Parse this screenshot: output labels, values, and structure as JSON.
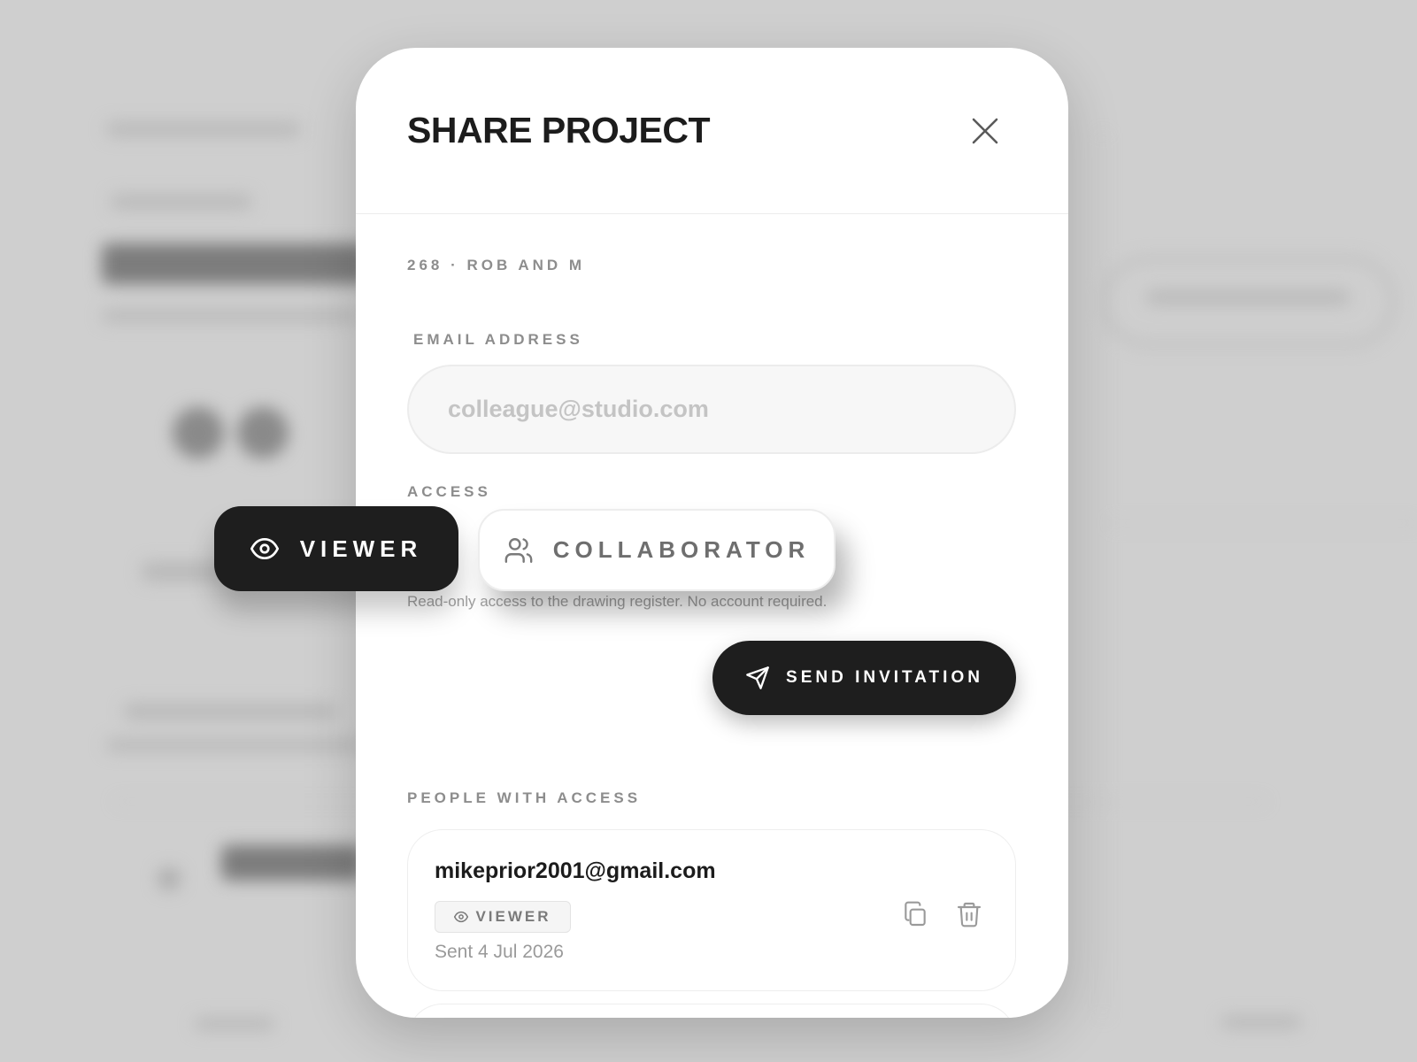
{
  "modal": {
    "title": "SHARE PROJECT",
    "project_ref": "268 · ROB AND M",
    "email_label": "EMAIL ADDRESS",
    "email_placeholder": "colleague@studio.com",
    "email_value": "",
    "access_label": "ACCESS",
    "access_options": [
      {
        "label": "VIEWER",
        "icon": "eye-icon",
        "selected": true
      },
      {
        "label": "COLLABORATOR",
        "icon": "users-icon",
        "selected": false
      }
    ],
    "access_hint": "Read-only access to the drawing register. No account required.",
    "send_label": "SEND INVITATION",
    "people_label": "PEOPLE WITH ACCESS",
    "people": [
      {
        "email": "mikeprior2001@gmail.com",
        "role": "VIEWER",
        "role_icon": "eye-icon",
        "sent": "Sent 4 Jul 2026"
      }
    ]
  },
  "colors": {
    "accent_dark": "#1e1e1e",
    "muted_text": "#8d8d8d",
    "backdrop": "#cfcfcf"
  }
}
